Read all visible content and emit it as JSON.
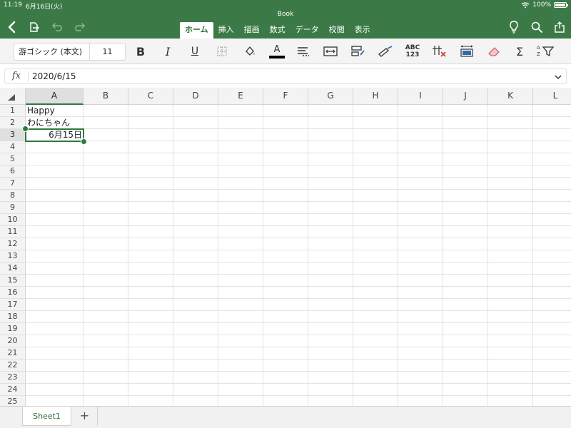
{
  "status": {
    "time": "11:19",
    "date": "6月16日(火)",
    "battery_text": "100%"
  },
  "document": {
    "title": "Book"
  },
  "toolbar": {
    "back_icon": "chevron-left-icon",
    "file_icon": "document-icon",
    "undo_icon": "undo-icon",
    "redo_icon": "redo-icon",
    "lightbulb_icon": "lightbulb-icon",
    "search_icon": "search-icon",
    "share_icon": "share-icon"
  },
  "tabs": [
    {
      "label": "ホーム",
      "active": true
    },
    {
      "label": "挿入",
      "active": false
    },
    {
      "label": "描画",
      "active": false
    },
    {
      "label": "数式",
      "active": false
    },
    {
      "label": "データ",
      "active": false
    },
    {
      "label": "校閲",
      "active": false
    },
    {
      "label": "表示",
      "active": false
    }
  ],
  "ribbon": {
    "font_name": "游ゴシック (本文)",
    "font_size": "11",
    "bold_label": "B",
    "italic_label": "I",
    "underline_label": "U",
    "font_color_letter": "A",
    "number_format_label_top": "ABC",
    "number_format_label_bottom": "123",
    "sum_label": "Σ",
    "sort_label_a": "A",
    "sort_label_z": "Z"
  },
  "formula_bar": {
    "fx_label": "fx",
    "value": "2020/6/15"
  },
  "grid": {
    "columns": [
      "A",
      "B",
      "C",
      "D",
      "E",
      "F",
      "G",
      "H",
      "I",
      "J",
      "K",
      "L"
    ],
    "rows": [
      "1",
      "2",
      "3",
      "4",
      "5",
      "6",
      "7",
      "8",
      "9",
      "10",
      "11",
      "12",
      "13",
      "14",
      "15",
      "16",
      "17",
      "18",
      "19",
      "20",
      "21",
      "22",
      "23",
      "24",
      "25"
    ],
    "selected_column": "A",
    "selected_row": "3",
    "cells": {
      "A1": "Happy",
      "A2": "わにちゃん",
      "A3": "6月15日"
    }
  },
  "sheets": {
    "tabs": [
      "Sheet1"
    ],
    "add_label": "+"
  },
  "colors": {
    "brand_green": "#3b7a47",
    "accent_green": "#2f7a3f"
  }
}
